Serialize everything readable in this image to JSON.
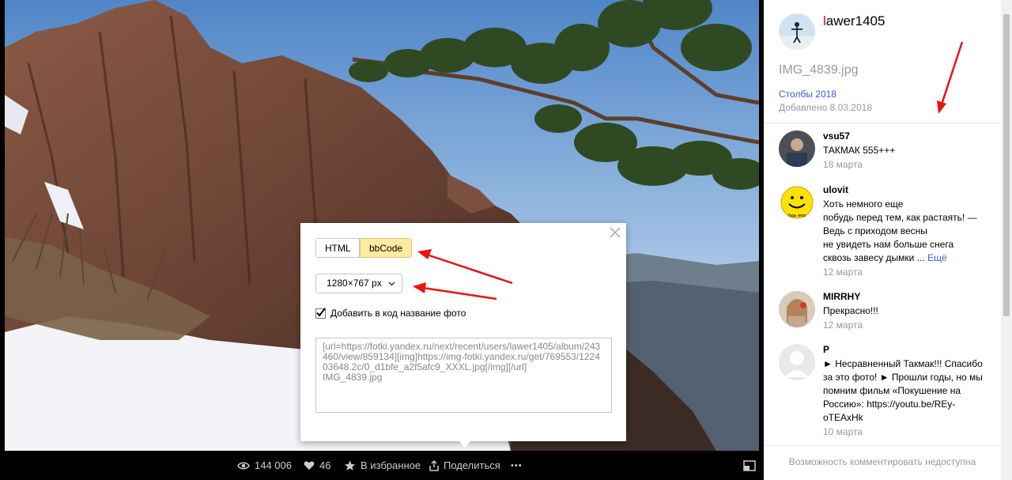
{
  "author": {
    "name_first": "l",
    "name_rest": "awer1405"
  },
  "photo": {
    "filename": "IMG_4839.jpg",
    "album": "Столбы 2018",
    "added": "Добавлено 8.03.2018"
  },
  "comments": [
    {
      "author": "vsu57",
      "text": "ТАКМАК 555+++",
      "date": "18 марта"
    },
    {
      "author": "ulovit",
      "lines": [
        "Хоть немного еще",
        "побудь перед тем, как растаять! —",
        "Ведь с приходом весны",
        "не увидеть нам больше снега",
        "сквозь завесу дымки ..."
      ],
      "more": "Ещё",
      "date": "12 марта"
    },
    {
      "author": "MIRRHY",
      "text": "Прекрасно!!!",
      "date": "12 марта"
    },
    {
      "author": "P",
      "lines": [
        "► Несравненный Такмак!!! Спасибо",
        "за это фото! ► Прошли годы, но мы",
        "помним фильм «Покушение на",
        "Россию»: https://youtu.be/REy-",
        "oTEAxHk"
      ],
      "date": "10 марта"
    }
  ],
  "footer_note": "Возможность комментировать недоступна",
  "bottom_bar": {
    "views": "144 006",
    "likes": "46",
    "favorite": "В избранное",
    "share": "Поделиться",
    "more": "•••"
  },
  "share_dialog": {
    "tab_html": "HTML",
    "tab_bbcode": "bbCode",
    "active_tab": "bbCode",
    "size": "1280×767 px",
    "include_title_label": "Добавить в код название фото",
    "include_title_checked": true,
    "code": "[url=https://fotki.yandex.ru/next/recent/users/lawer1405/album/243460/view/859134][img]https://img-fotki.yandex.ru/get/769553/122403648.2c/0_d1bfe_a2f5afc9_XXXL.jpg[/img][/url]\nIMG_4839.jpg"
  },
  "icons": [
    "eye-icon",
    "heart-icon",
    "star-icon",
    "share-icon",
    "more-icon",
    "fullscreen-icon",
    "close-icon",
    "chevron-down-icon",
    "checkmark-icon"
  ],
  "colors": {
    "accent_link": "#3a5ed8",
    "tab_active": "#ffeba0",
    "author_first_letter": "#ff0000",
    "annotation_arrow": "#ee1111"
  }
}
